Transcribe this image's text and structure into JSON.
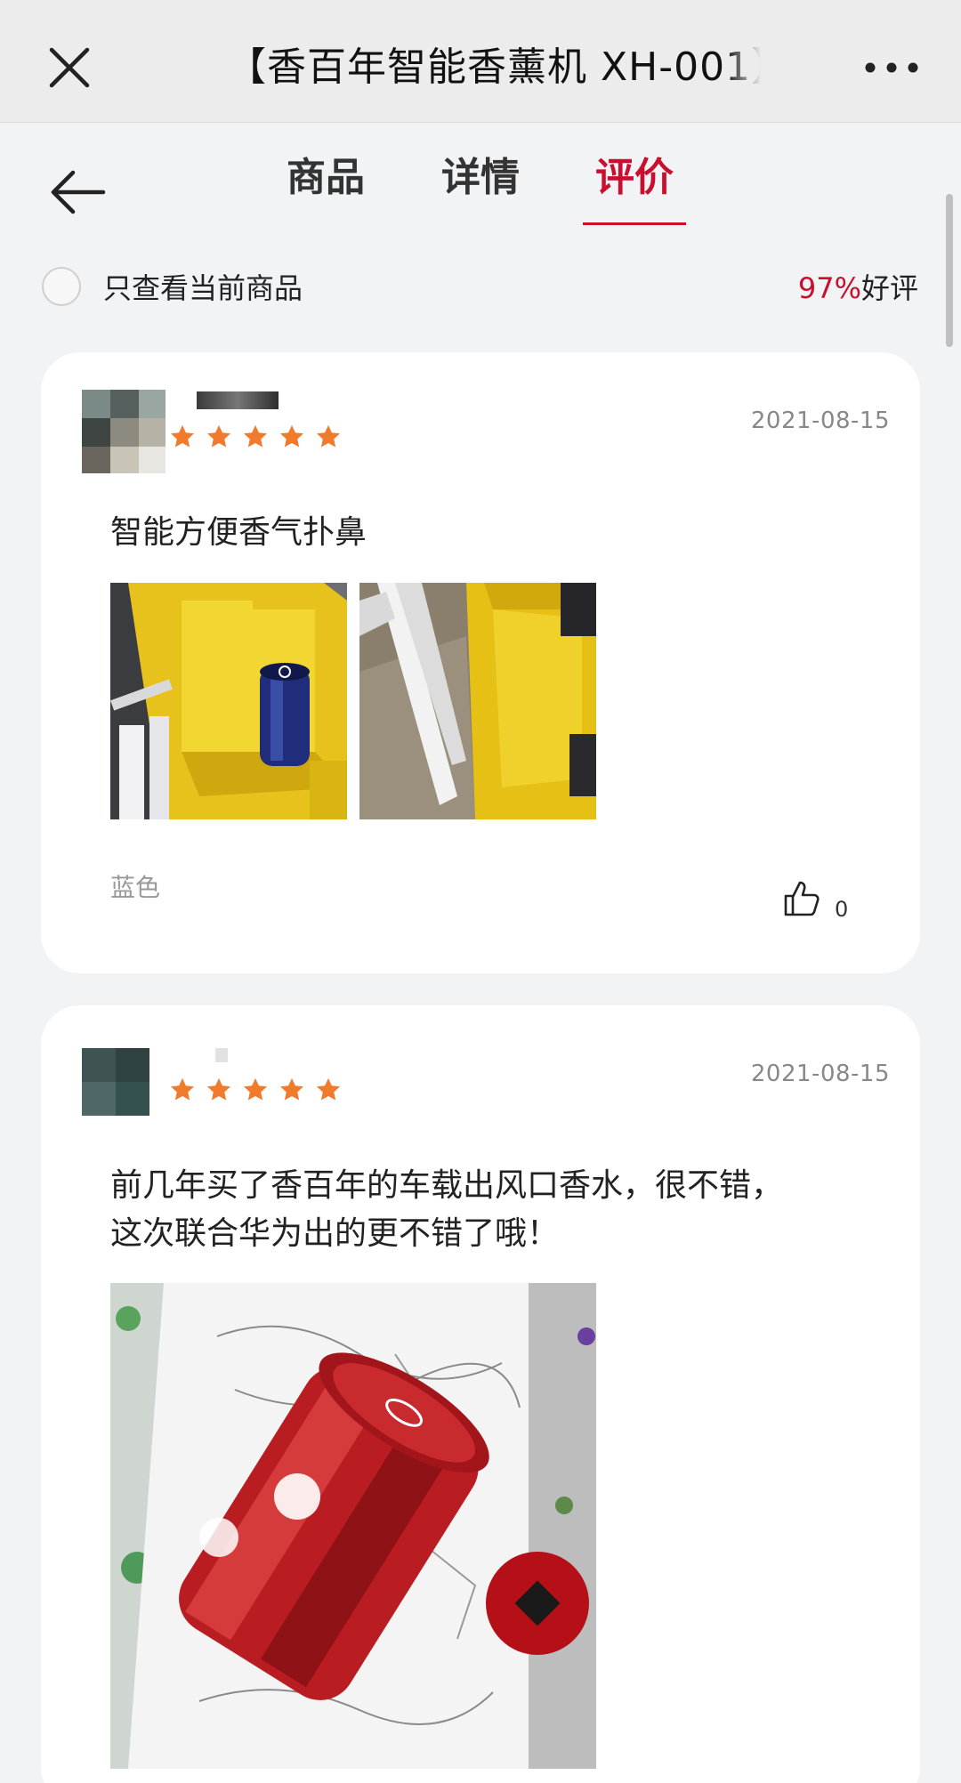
{
  "header": {
    "title": "【香百年智能香薰机 XH-001】",
    "close_icon": "close-icon",
    "more_icon": "more-icon"
  },
  "nav": {
    "back_icon": "back-arrow-icon",
    "tabs": [
      {
        "label": "商品",
        "active": false
      },
      {
        "label": "详情",
        "active": false
      },
      {
        "label": "评价",
        "active": true
      }
    ]
  },
  "filter": {
    "label": "只查看当前商品",
    "rating_percent": "97%",
    "rating_label": "好评"
  },
  "colors": {
    "accent": "#c8102e",
    "star": "#f07b2c",
    "background": "#f2f3f5"
  },
  "reviews": [
    {
      "stars": 5,
      "date": "2021-08-15",
      "text": "智能方便香气扑鼻",
      "variant": "蓝色",
      "likes": "0"
    },
    {
      "stars": 5,
      "date": "2021-08-15",
      "text": "前几年买了香百年的车载出风口香水，很不错，",
      "text2": "这次联合华为出的更不错了哦！"
    }
  ]
}
